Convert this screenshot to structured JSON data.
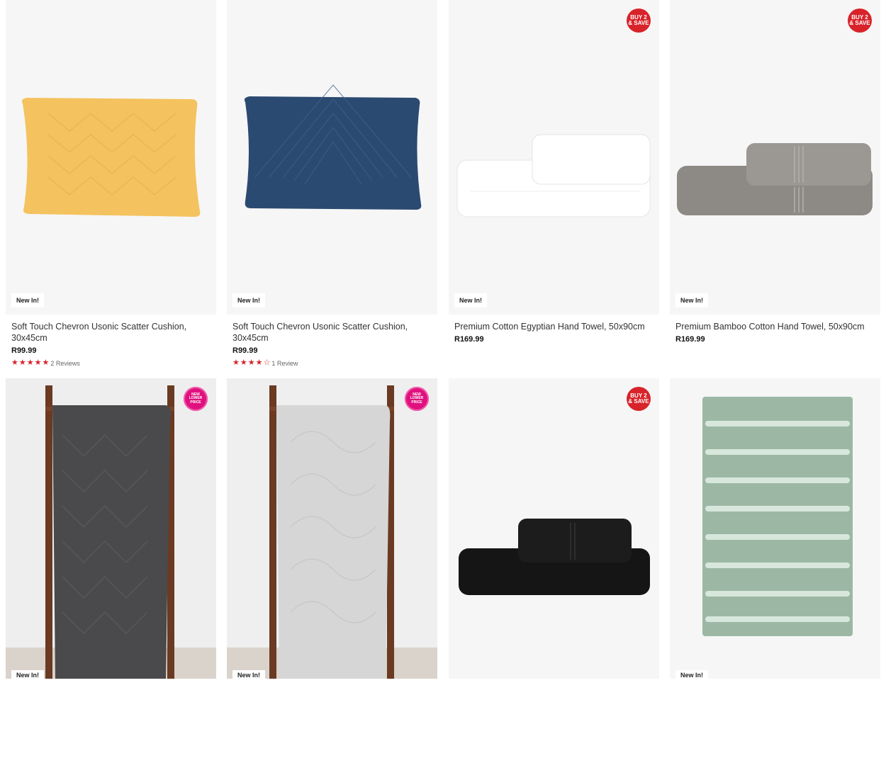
{
  "products": [
    {
      "title": "Soft Touch Chevron Usonic Scatter Cushion, 30x45cm",
      "price": "R99.99",
      "badge": "New In!",
      "reviews": "2 Reviews",
      "rating": 5
    },
    {
      "title": "Soft Touch Chevron Usonic Scatter Cushion, 30x45cm",
      "price": "R99.99",
      "badge": "New In!",
      "reviews": "1 Review",
      "rating": 4
    },
    {
      "title": "Premium Cotton Egyptian Hand Towel, 50x90cm",
      "price": "R169.99",
      "badge": "New In!",
      "promo": [
        "BUY 2",
        "& SAVE"
      ]
    },
    {
      "title": "Premium Bamboo Cotton Hand Towel, 50x90cm",
      "price": "R169.99",
      "badge": "New In!",
      "promo": [
        "BUY 2",
        "& SAVE"
      ]
    },
    {
      "badge": "New In!",
      "promo": [
        "NEW",
        "LOWER",
        "PRICE"
      ]
    },
    {
      "badge": "New In!",
      "promo": [
        "NEW",
        "LOWER",
        "PRICE"
      ]
    },
    {
      "promo": [
        "BUY 2",
        "& SAVE"
      ]
    },
    {
      "badge": "New In!"
    }
  ],
  "colors": {
    "accent": "#d8232a",
    "promo_pink": "#e0117f",
    "cushion_yellow": "#f4c25e",
    "cushion_navy": "#2b4a72",
    "towel_white": "#ffffff",
    "towel_grey": "#8d8a86",
    "throw_charcoal": "#4a4a4c",
    "throw_light": "#d6d6d6",
    "towel_black": "#151515",
    "mat_sage": "#9cb8a4"
  }
}
